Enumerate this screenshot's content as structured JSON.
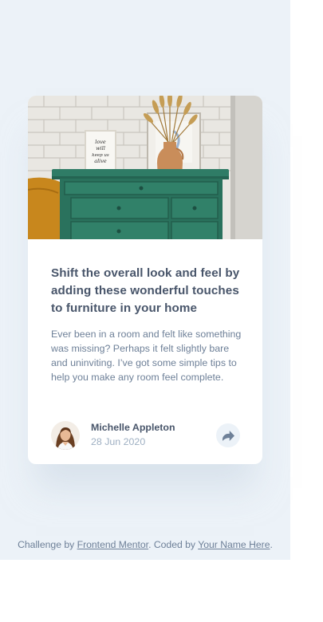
{
  "article": {
    "title": "Shift the overall look and feel by adding these wonderful touches to furniture in your home",
    "description": "Ever been in a room and felt like something was missing? Perhaps it felt slightly bare and uninviting. I’ve got some simple tips to help you make any room feel complete.",
    "image_icon": "drawers-photo",
    "poster_text": [
      "love",
      "will",
      "keep us",
      "alive"
    ]
  },
  "author": {
    "name": "Michelle Appleton",
    "date": "28 Jun 2020",
    "avatar_icon": "avatar-photo"
  },
  "share": {
    "icon": "share-icon"
  },
  "attribution": {
    "prefix": "Challenge by ",
    "link1": "Frontend Mentor",
    "middle": ". Coded by ",
    "link2": "Your Name Here",
    "suffix": "."
  },
  "colors": {
    "background": "#ecf2f8",
    "card": "#ffffff",
    "title": "#48556a",
    "text": "#6e8098",
    "muted": "#9eafc2",
    "drawer_green": "#2f7c66"
  }
}
